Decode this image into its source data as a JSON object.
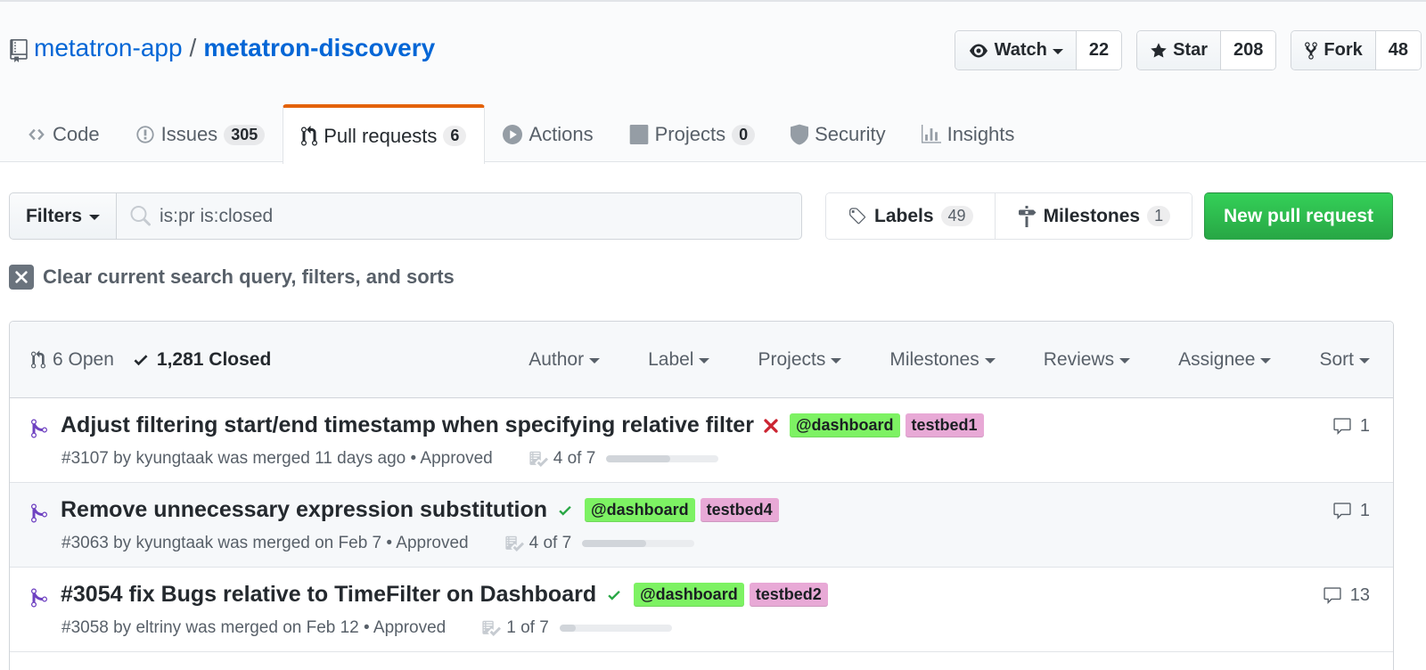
{
  "repo": {
    "owner": "metatron-app",
    "separator": "/",
    "name": "metatron-discovery"
  },
  "actions": {
    "watch": {
      "label": "Watch",
      "count": "22"
    },
    "star": {
      "label": "Star",
      "count": "208"
    },
    "fork": {
      "label": "Fork",
      "count": "48"
    }
  },
  "nav": {
    "code": {
      "label": "Code"
    },
    "issues": {
      "label": "Issues",
      "count": "305"
    },
    "pulls": {
      "label": "Pull requests",
      "count": "6"
    },
    "actions": {
      "label": "Actions"
    },
    "projects": {
      "label": "Projects",
      "count": "0"
    },
    "security": {
      "label": "Security"
    },
    "insights": {
      "label": "Insights"
    }
  },
  "accent_color": "#e36209",
  "subnav": {
    "filters_label": "Filters",
    "search_value": "is:pr is:closed",
    "labels": {
      "label": "Labels",
      "count": "49"
    },
    "milestones": {
      "label": "Milestones",
      "count": "1"
    },
    "new_pr_label": "New pull request"
  },
  "clear_query_label": "Clear current search query, filters, and sorts",
  "states": {
    "open": "6 Open",
    "closed": "1,281 Closed"
  },
  "table_filters": {
    "author": "Author",
    "label": "Label",
    "projects": "Projects",
    "milestones": "Milestones",
    "reviews": "Reviews",
    "assignee": "Assignee",
    "sort": "Sort"
  },
  "pulls": [
    {
      "title": "Adjust filtering start/end timestamp when specifying relative filter",
      "status": "failure",
      "labels": [
        {
          "name": "@dashboard",
          "color": "#7df263"
        },
        {
          "name": "testbed1",
          "color": "#e8a9d6"
        }
      ],
      "meta": "#3107 by kyungtaak was merged 11 days ago • Approved",
      "tasks": "4 of 7",
      "progress": 0.571,
      "comments": "1"
    },
    {
      "title": "Remove unnecessary expression substitution",
      "status": "success",
      "labels": [
        {
          "name": "@dashboard",
          "color": "#7df263"
        },
        {
          "name": "testbed4",
          "color": "#e8a9d6"
        }
      ],
      "meta": "#3063 by kyungtaak was merged on Feb 7 • Approved",
      "tasks": "4 of 7",
      "progress": 0.571,
      "comments": "1"
    },
    {
      "title": "#3054 fix Bugs relative to TimeFilter on Dashboard",
      "status": "success",
      "labels": [
        {
          "name": "@dashboard",
          "color": "#7df263"
        },
        {
          "name": "testbed2",
          "color": "#e8a9d6"
        }
      ],
      "meta": "#3058 by eltriny was merged on Feb 12 • Approved",
      "tasks": "1 of 7",
      "progress": 0.143,
      "comments": "13"
    }
  ]
}
